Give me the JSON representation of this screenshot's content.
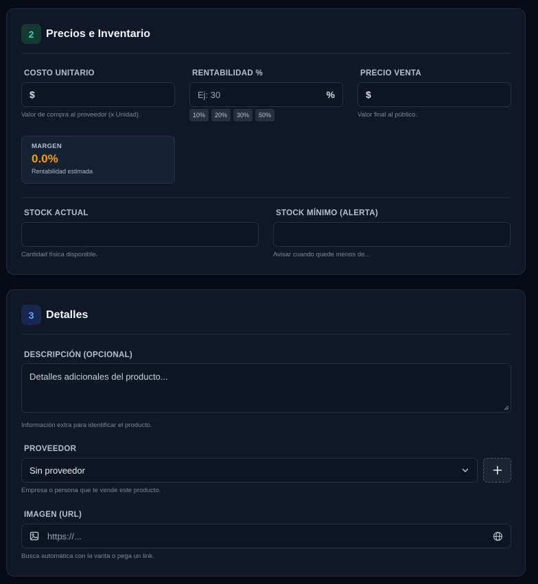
{
  "pricing": {
    "step": "2",
    "title": "Precios e Inventario",
    "unit_cost": {
      "label": "COSTO UNITARIO",
      "prefix": "$",
      "hint": "Valor de compra al proveedor (x Unidad)."
    },
    "profitability": {
      "label": "RENTABILIDAD %",
      "placeholder": "Ej: 30",
      "suffix": "%",
      "presets": [
        "10%",
        "20%",
        "30%",
        "50%"
      ]
    },
    "sale_price": {
      "label": "PRECIO VENTA",
      "prefix": "$",
      "hint": "Valor final al público."
    },
    "margin": {
      "label": "MARGEN",
      "value": "0.0%",
      "subtitle": "Rentabilidad estimada"
    },
    "stock_current": {
      "label": "STOCK ACTUAL",
      "hint": "Cantidad física disponible."
    },
    "stock_min": {
      "label": "STOCK MÍNIMO (ALERTA)",
      "hint": "Avisar cuando quede menos de..."
    }
  },
  "details": {
    "step": "3",
    "title": "Detalles",
    "description": {
      "label": "DESCRIPCIÓN (OPCIONAL)",
      "placeholder": "Detalles adicionales del producto...",
      "hint": "Información extra para identificar el producto."
    },
    "supplier": {
      "label": "PROVEEDOR",
      "selected": "Sin proveedor",
      "hint": "Empresa o persona que te vende este producto.",
      "add_icon": "plus-icon"
    },
    "image": {
      "label": "IMAGEN (URL)",
      "placeholder": "https://...",
      "hint": "Busca automática con la varita o pega un link.",
      "leading_icon": "image-icon",
      "trailing_icon": "globe-icon"
    }
  },
  "colors": {
    "background": "#070b16",
    "card": "#0f1728",
    "accent_green": "#34d399",
    "accent_blue": "#60a5fa",
    "margin_value": "#f59e0b"
  }
}
